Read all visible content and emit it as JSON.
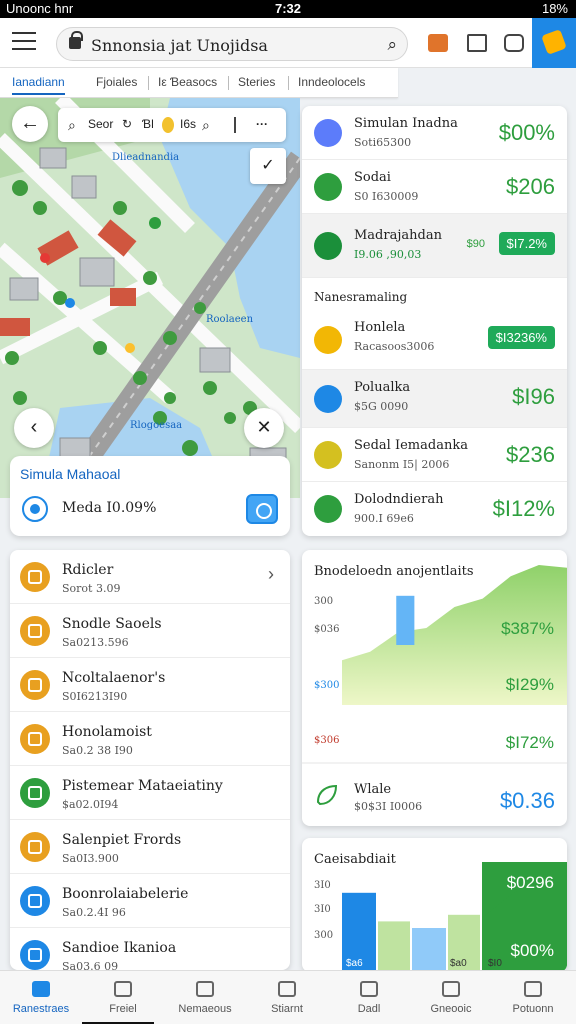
{
  "status": {
    "carrier": "Unoonc hnr",
    "time": "7:32",
    "battery": "18%"
  },
  "appbar": {
    "title": "Snnonsia jat Unojidsa"
  },
  "tabs": [
    "Ianadiann",
    "Fjoiales",
    "Iε Ɓeasocs",
    "Steries",
    "Inndeolocels"
  ],
  "map": {
    "search_a": "Seor",
    "search_b": "Ɓl",
    "search_c": "I6s",
    "more": "···",
    "labels": [
      "Dlieadnandia",
      "Roolaeen",
      "Rlogoesaa"
    ]
  },
  "sim_card": {
    "heading": "Simula Mahaoal",
    "value": "Meda I0.09%"
  },
  "right_panel": {
    "rows": [
      {
        "title": "Simulan Inadna",
        "sub": "Soti65300",
        "value": "$00%",
        "color": "#5c7cfa"
      },
      {
        "title": "Sodai",
        "sub": "S0 I630009",
        "value": "$206",
        "color": "#2e9e3e"
      },
      {
        "title": "Madrajahdan",
        "sub": "I9.06 ,90,03",
        "value": "$I7.2%",
        "prefix": "$90",
        "color": "#1b8f3a"
      }
    ],
    "section": "Nanesramaling",
    "rows2": [
      {
        "title": "Honlela",
        "sub": "Racasoos3006",
        "value": "$I3236%",
        "color": "#f2b705"
      },
      {
        "title": "Polualka",
        "sub": "$5G 0090",
        "value": "$I96",
        "color": "#1e88e5"
      },
      {
        "title": "Sedal Iemadanka",
        "sub": "Sanonm I5| 2006",
        "value": "$236",
        "color": "#d4c020"
      },
      {
        "title": "Dolodndierah",
        "sub": "900.I 69e6",
        "value": "$I12%",
        "color": "#2e9e3e"
      }
    ]
  },
  "list": [
    {
      "title": "Rdicler",
      "sub": "Sorot 3.09",
      "color": "#e8a020"
    },
    {
      "title": "Snodle Saoels",
      "sub": "Sa0213.596",
      "color": "#e8a020"
    },
    {
      "title": "Ncoltalaenor's",
      "sub": "S0I6213I90",
      "color": "#e8a020"
    },
    {
      "title": "Honolamoist",
      "sub": "Sa0.2 38 I90",
      "color": "#e8a020"
    },
    {
      "title": "Pistemear Mataeiatiny",
      "sub": "$a02.0I94",
      "color": "#2e9e3e"
    },
    {
      "title": "Salenpiet Frords",
      "sub": "Sa0I3.900",
      "color": "#e8a020"
    },
    {
      "title": "Boonrolaiabelerie",
      "sub": "Sa0.2.4I 96",
      "color": "#1e88e5"
    },
    {
      "title": "Sandioe Ikanioa",
      "sub": "Sa03.6 09",
      "color": "#1e88e5"
    }
  ],
  "chart1": {
    "title": "Bnodeloedn anojentlaits",
    "yticks": [
      "300",
      "$036",
      "$300",
      "$306"
    ],
    "ytick_colors": [
      "#555555",
      "#555555",
      "#1e88e5",
      "#c0392b"
    ],
    "annotations": [
      "$387%",
      "$I29%",
      "$I72%"
    ],
    "footer_title": "Wlale",
    "footer_sub": "$0$3I I0006",
    "footer_value": "$0.36"
  },
  "chart_data": {
    "type": "area",
    "title": "Bnodeloedn anojentlaits",
    "x": [
      0,
      1,
      2,
      3,
      4,
      5,
      6,
      7,
      8
    ],
    "series": [
      {
        "values": [
          32,
          38,
          52,
          55,
          70,
          76,
          92,
          100,
          98
        ]
      },
      {
        "values": [
          0,
          0,
          78,
          78,
          0,
          0,
          0,
          0,
          0
        ]
      }
    ],
    "ylim": [
      0,
      100
    ]
  },
  "chart2": {
    "title": "Caeisabdiait",
    "yticks": [
      "3I0",
      "3I0",
      "300"
    ],
    "annotations": [
      "$0296",
      "$00%"
    ],
    "bar_labels": [
      "$a6",
      "$a0",
      "$I0"
    ],
    "bars": [
      {
        "value": 72,
        "color": "#1e88e5"
      },
      {
        "value": 46,
        "color": "#bfe3a0"
      },
      {
        "value": 40,
        "color": "#90caf9"
      },
      {
        "value": 52,
        "color": "#bfe3a0"
      },
      {
        "value": 100,
        "color": "#2e9e3e"
      }
    ]
  },
  "bottom_nav": [
    "Ranestraes",
    "Freiel",
    "Nemaeous",
    "Stiarnt",
    "Dadl",
    "Gneooic",
    "Potuonn"
  ]
}
